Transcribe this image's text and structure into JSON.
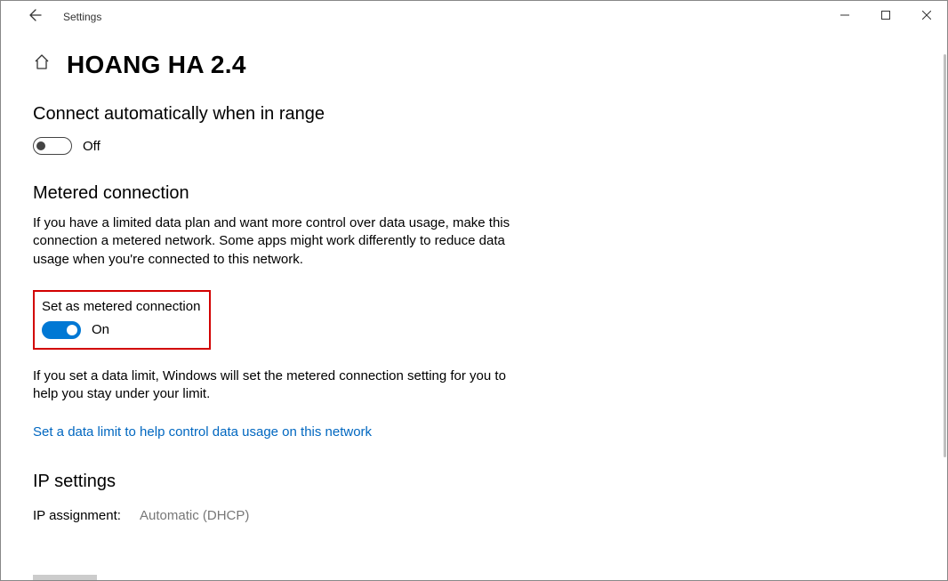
{
  "window": {
    "app_title": "Settings"
  },
  "header": {
    "page_title": "HOANG HA 2.4"
  },
  "connect_auto": {
    "title": "Connect automatically when in range",
    "toggle_state": "Off"
  },
  "metered": {
    "title": "Metered connection",
    "description": "If you have a limited data plan and want more control over data usage, make this connection a metered network. Some apps might work differently to reduce data usage when you're connected to this network.",
    "setting_label": "Set as metered connection",
    "toggle_state": "On",
    "limit_text": "If you set a data limit, Windows will set the metered connection setting for you to help you stay under your limit.",
    "link": "Set a data limit to help control data usage on this network"
  },
  "ip": {
    "title": "IP settings",
    "assignment_label": "IP assignment:",
    "assignment_value": "Automatic (DHCP)"
  }
}
